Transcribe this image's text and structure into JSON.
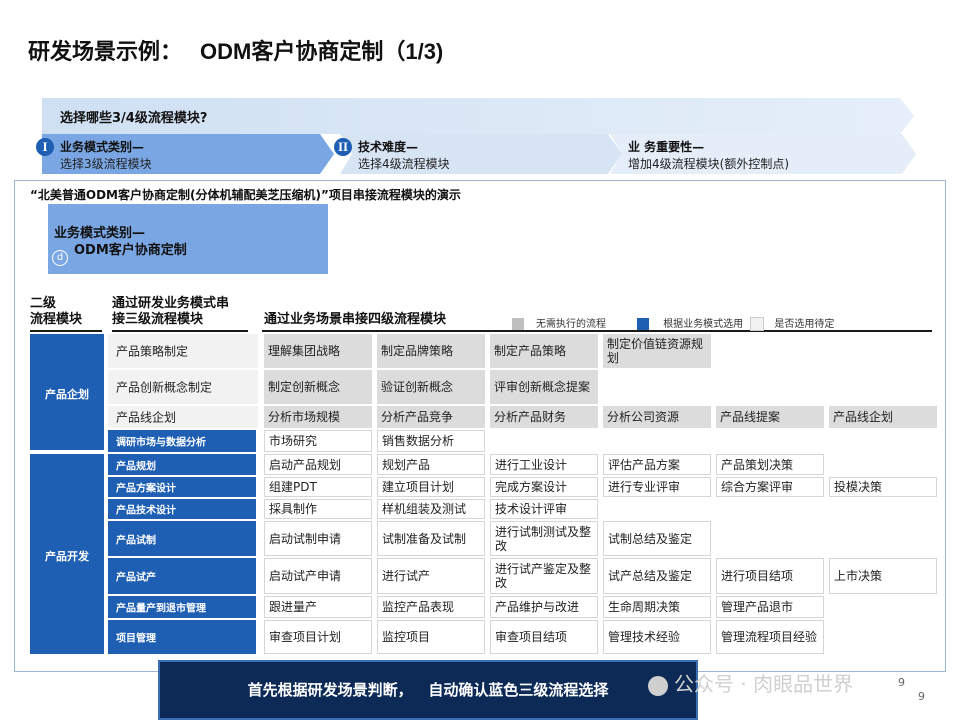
{
  "title": "研发场景示例：",
  "title_odm": "ODM客户协商定制（1/3)",
  "banner": {
    "question": "选择哪些3/4级流程模块?",
    "chevrons": [
      {
        "badge": "I",
        "line1": "业务模式类别—",
        "line2": "选择3级流程模块"
      },
      {
        "badge": "II",
        "line1": "技术难度—",
        "line2": "选择4级流程模块"
      },
      {
        "badge": "",
        "line1": "业 务重要性—",
        "line2": "增加4级流程模块(额外控制点)"
      }
    ]
  },
  "demo_title": "“北美普通ODM客户协商定制(分体机辅配美芝压缩机)”项目串接流程模块的演示",
  "mode_box": {
    "line1": "业务模式类别—",
    "line2": "ODM客户协商定制",
    "marker": "d"
  },
  "headers": {
    "col1": [
      "二级",
      "流程模块"
    ],
    "col2": [
      "通过研发业务模式串",
      "接三级流程模块"
    ],
    "col3": "通过业务场景串接四级流程模块"
  },
  "legend": [
    {
      "label": "无需执行的流程",
      "color": "#bfbfbf"
    },
    {
      "label": "根据业务模式选用",
      "color": "#1e5fb4"
    },
    {
      "label": "是否选用待定",
      "color": "#f2f2f2"
    }
  ],
  "categories": [
    "产品企划",
    "产品开发"
  ],
  "rows": [
    {
      "l3": "产品策略制定",
      "l3style": "gray",
      "cells": [
        {
          "t": "理解集团战略",
          "s": "g"
        },
        {
          "t": "制定品牌策略",
          "s": "g"
        },
        {
          "t": "制定产品策略",
          "s": "g"
        },
        {
          "t": "制定价值链资源规划",
          "s": "g"
        }
      ]
    },
    {
      "l3": "产品创新概念制定",
      "l3style": "gray",
      "cells": [
        {
          "t": "制定创新概念",
          "s": "g"
        },
        {
          "t": "验证创新概念",
          "s": "g"
        },
        {
          "t": "评审创新概念提案",
          "s": "g"
        }
      ]
    },
    {
      "l3": "产品线企划",
      "l3style": "gray",
      "cells": [
        {
          "t": "分析市场规模",
          "s": "g"
        },
        {
          "t": "分析产品竞争",
          "s": "g"
        },
        {
          "t": "分析产品财务",
          "s": "g"
        },
        {
          "t": "分析公司资源",
          "s": "g"
        },
        {
          "t": "产品线提案",
          "s": "g"
        },
        {
          "t": "产品线企划",
          "s": "g"
        }
      ]
    },
    {
      "l3": "调研市场与数据分析",
      "l3style": "blue",
      "cells": [
        {
          "t": "市场研究",
          "s": "w"
        },
        {
          "t": "销售数据分析",
          "s": "w"
        }
      ]
    },
    {
      "l3": "产品规划",
      "l3style": "blue",
      "cells": [
        {
          "t": "启动产品规划",
          "s": "w"
        },
        {
          "t": "规划产品",
          "s": "w"
        },
        {
          "t": "进行工业设计",
          "s": "w"
        },
        {
          "t": "评估产品方案",
          "s": "w"
        },
        {
          "t": "产品策划决策",
          "s": "w"
        }
      ]
    },
    {
      "l3": "产品方案设计",
      "l3style": "blue",
      "cells": [
        {
          "t": "组建PDT",
          "s": "w"
        },
        {
          "t": "建立项目计划",
          "s": "w"
        },
        {
          "t": "完成方案设计",
          "s": "w"
        },
        {
          "t": "进行专业评审",
          "s": "w"
        },
        {
          "t": "综合方案评审",
          "s": "w"
        },
        {
          "t": "投模决策",
          "s": "w"
        }
      ]
    },
    {
      "l3": "产品技术设计",
      "l3style": "blue",
      "cells": [
        {
          "t": "採具制作",
          "s": "w"
        },
        {
          "t": "样机组装及测试",
          "s": "w"
        },
        {
          "t": "技术设计评审",
          "s": "w"
        }
      ]
    },
    {
      "l3": "产品试制",
      "l3style": "blue",
      "cells": [
        {
          "t": "启动试制申请",
          "s": "w"
        },
        {
          "t": "试制准备及试制",
          "s": "w"
        },
        {
          "t": "进行试制测试及整改",
          "s": "w"
        },
        {
          "t": "试制总结及鉴定",
          "s": "w"
        }
      ]
    },
    {
      "l3": "产品试产",
      "l3style": "blue",
      "cells": [
        {
          "t": "启动试产申请",
          "s": "w"
        },
        {
          "t": "进行试产",
          "s": "w"
        },
        {
          "t": "进行试产鉴定及整改",
          "s": "w"
        },
        {
          "t": "试产总结及鉴定",
          "s": "w"
        },
        {
          "t": "进行项目结项",
          "s": "w"
        },
        {
          "t": "上市决策",
          "s": "w"
        }
      ]
    },
    {
      "l3": "产品量产到退市管理",
      "l3style": "blue",
      "cells": [
        {
          "t": "跟进量产",
          "s": "w"
        },
        {
          "t": "监控产品表现",
          "s": "w"
        },
        {
          "t": "产品维护与改进",
          "s": "w"
        },
        {
          "t": "生命周期决策",
          "s": "w"
        },
        {
          "t": "管理产品退市",
          "s": "w"
        }
      ]
    },
    {
      "l3": "项目管理",
      "l3style": "blue",
      "cells": [
        {
          "t": "审查项目计划",
          "s": "w"
        },
        {
          "t": "监控项目",
          "s": "w"
        },
        {
          "t": "审查项目结项",
          "s": "w"
        },
        {
          "t": "管理技术经验",
          "s": "w"
        },
        {
          "t": "管理流程项目经验",
          "s": "w"
        }
      ]
    }
  ],
  "footer": "首先根据研发场景判断，   自动确认蓝色三级流程选择",
  "watermark": "公众号 · 肉眼品世界",
  "page_num": "9"
}
